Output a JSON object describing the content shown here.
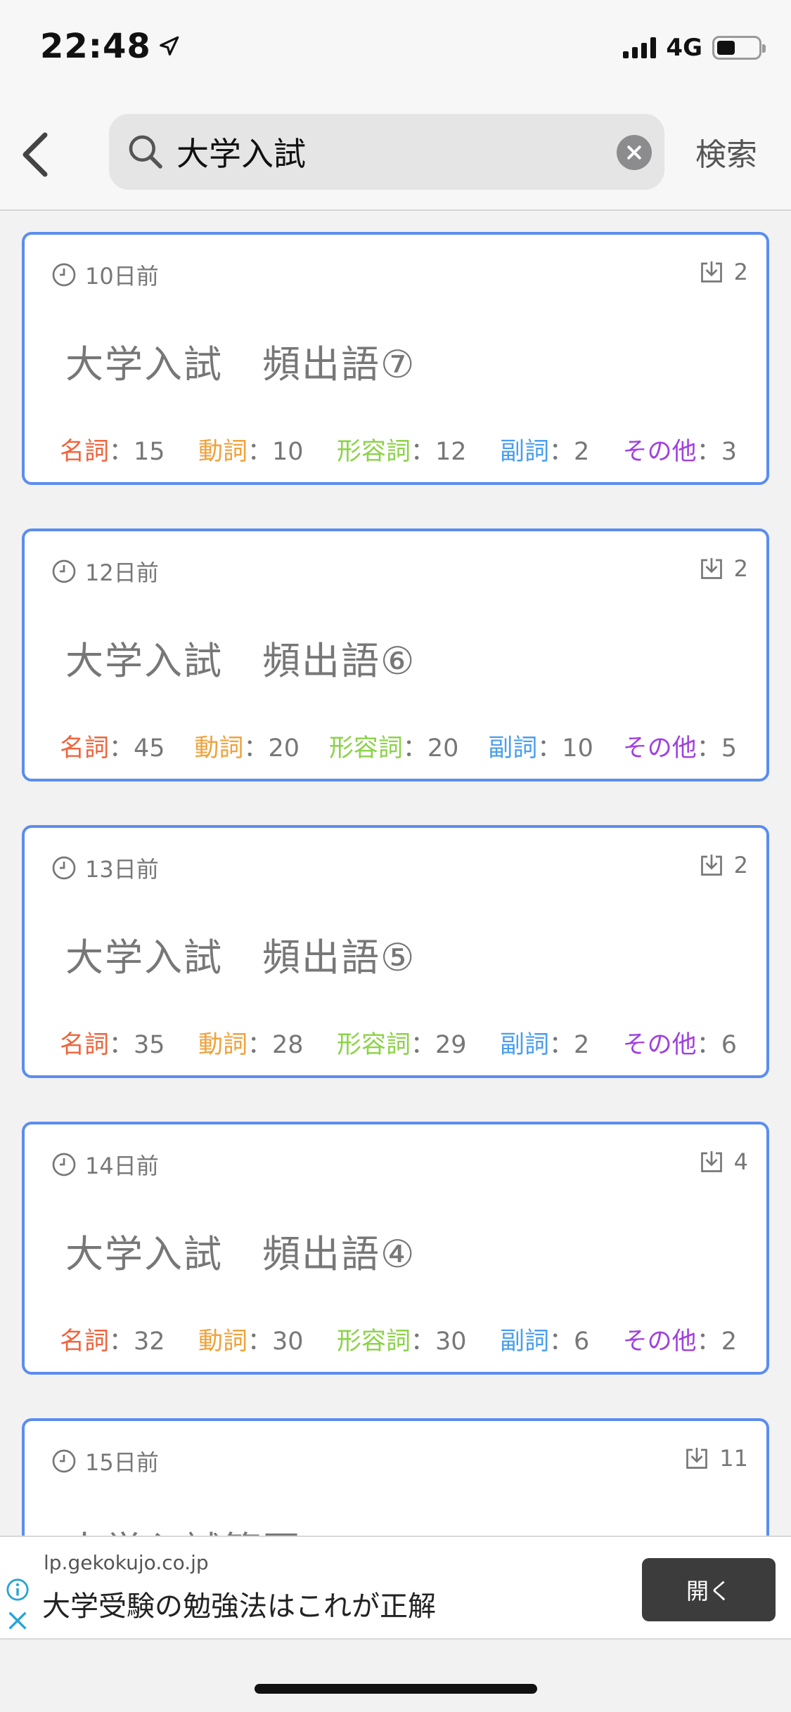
{
  "status_bar": {
    "time": "22:48",
    "network": "4G",
    "battery_level": 0.45
  },
  "search": {
    "query": "大学入試",
    "placeholder": "",
    "submit_label": "検索"
  },
  "colors": {
    "card_border": "#5b8def",
    "noun": "#f0643c",
    "verb": "#f0a23c",
    "adjective": "#8cd24a",
    "adverb": "#4a9ef0",
    "other": "#a040e0"
  },
  "cards": [
    {
      "date": "10日前",
      "downloads": "2",
      "title": "大学入試　頻出語⑦",
      "stats": [
        {
          "label": "名詞",
          "sep": "：",
          "value": "15"
        },
        {
          "label": "動詞",
          "sep": "：",
          "value": "10"
        },
        {
          "label": "形容詞",
          "sep": "：",
          "value": "12"
        },
        {
          "label": "副詞",
          "sep": "：",
          "value": "2"
        },
        {
          "label": "その他",
          "sep": "：",
          "value": "3"
        }
      ]
    },
    {
      "date": "12日前",
      "downloads": "2",
      "title": "大学入試　頻出語⑥",
      "stats": [
        {
          "label": "名詞",
          "sep": "：",
          "value": "45"
        },
        {
          "label": "動詞",
          "sep": "：",
          "value": "20"
        },
        {
          "label": "形容詞",
          "sep": "：",
          "value": "20"
        },
        {
          "label": "副詞",
          "sep": "：",
          "value": "10"
        },
        {
          "label": "その他",
          "sep": "：",
          "value": "5"
        }
      ]
    },
    {
      "date": "13日前",
      "downloads": "2",
      "title": "大学入試　頻出語⑤",
      "stats": [
        {
          "label": "名詞",
          "sep": "：",
          "value": "35"
        },
        {
          "label": "動詞",
          "sep": "：",
          "value": "28"
        },
        {
          "label": "形容詞",
          "sep": "：",
          "value": "29"
        },
        {
          "label": "副詞",
          "sep": "：",
          "value": "2"
        },
        {
          "label": "その他",
          "sep": "：",
          "value": "6"
        }
      ]
    },
    {
      "date": "14日前",
      "downloads": "4",
      "title": "大学入試　頻出語④",
      "stats": [
        {
          "label": "名詞",
          "sep": "：",
          "value": "32"
        },
        {
          "label": "動詞",
          "sep": "：",
          "value": "30"
        },
        {
          "label": "形容詞",
          "sep": "：",
          "value": "30"
        },
        {
          "label": "副詞",
          "sep": "：",
          "value": "6"
        },
        {
          "label": "その他",
          "sep": "：",
          "value": "2"
        }
      ]
    },
    {
      "date": "15日前",
      "downloads": "11",
      "title": "大学入試範囲",
      "stats": []
    }
  ],
  "ad": {
    "domain": "lp.gekokujo.co.jp",
    "headline": "大学受験の勉強法はこれが正解",
    "cta_label": "開く"
  }
}
